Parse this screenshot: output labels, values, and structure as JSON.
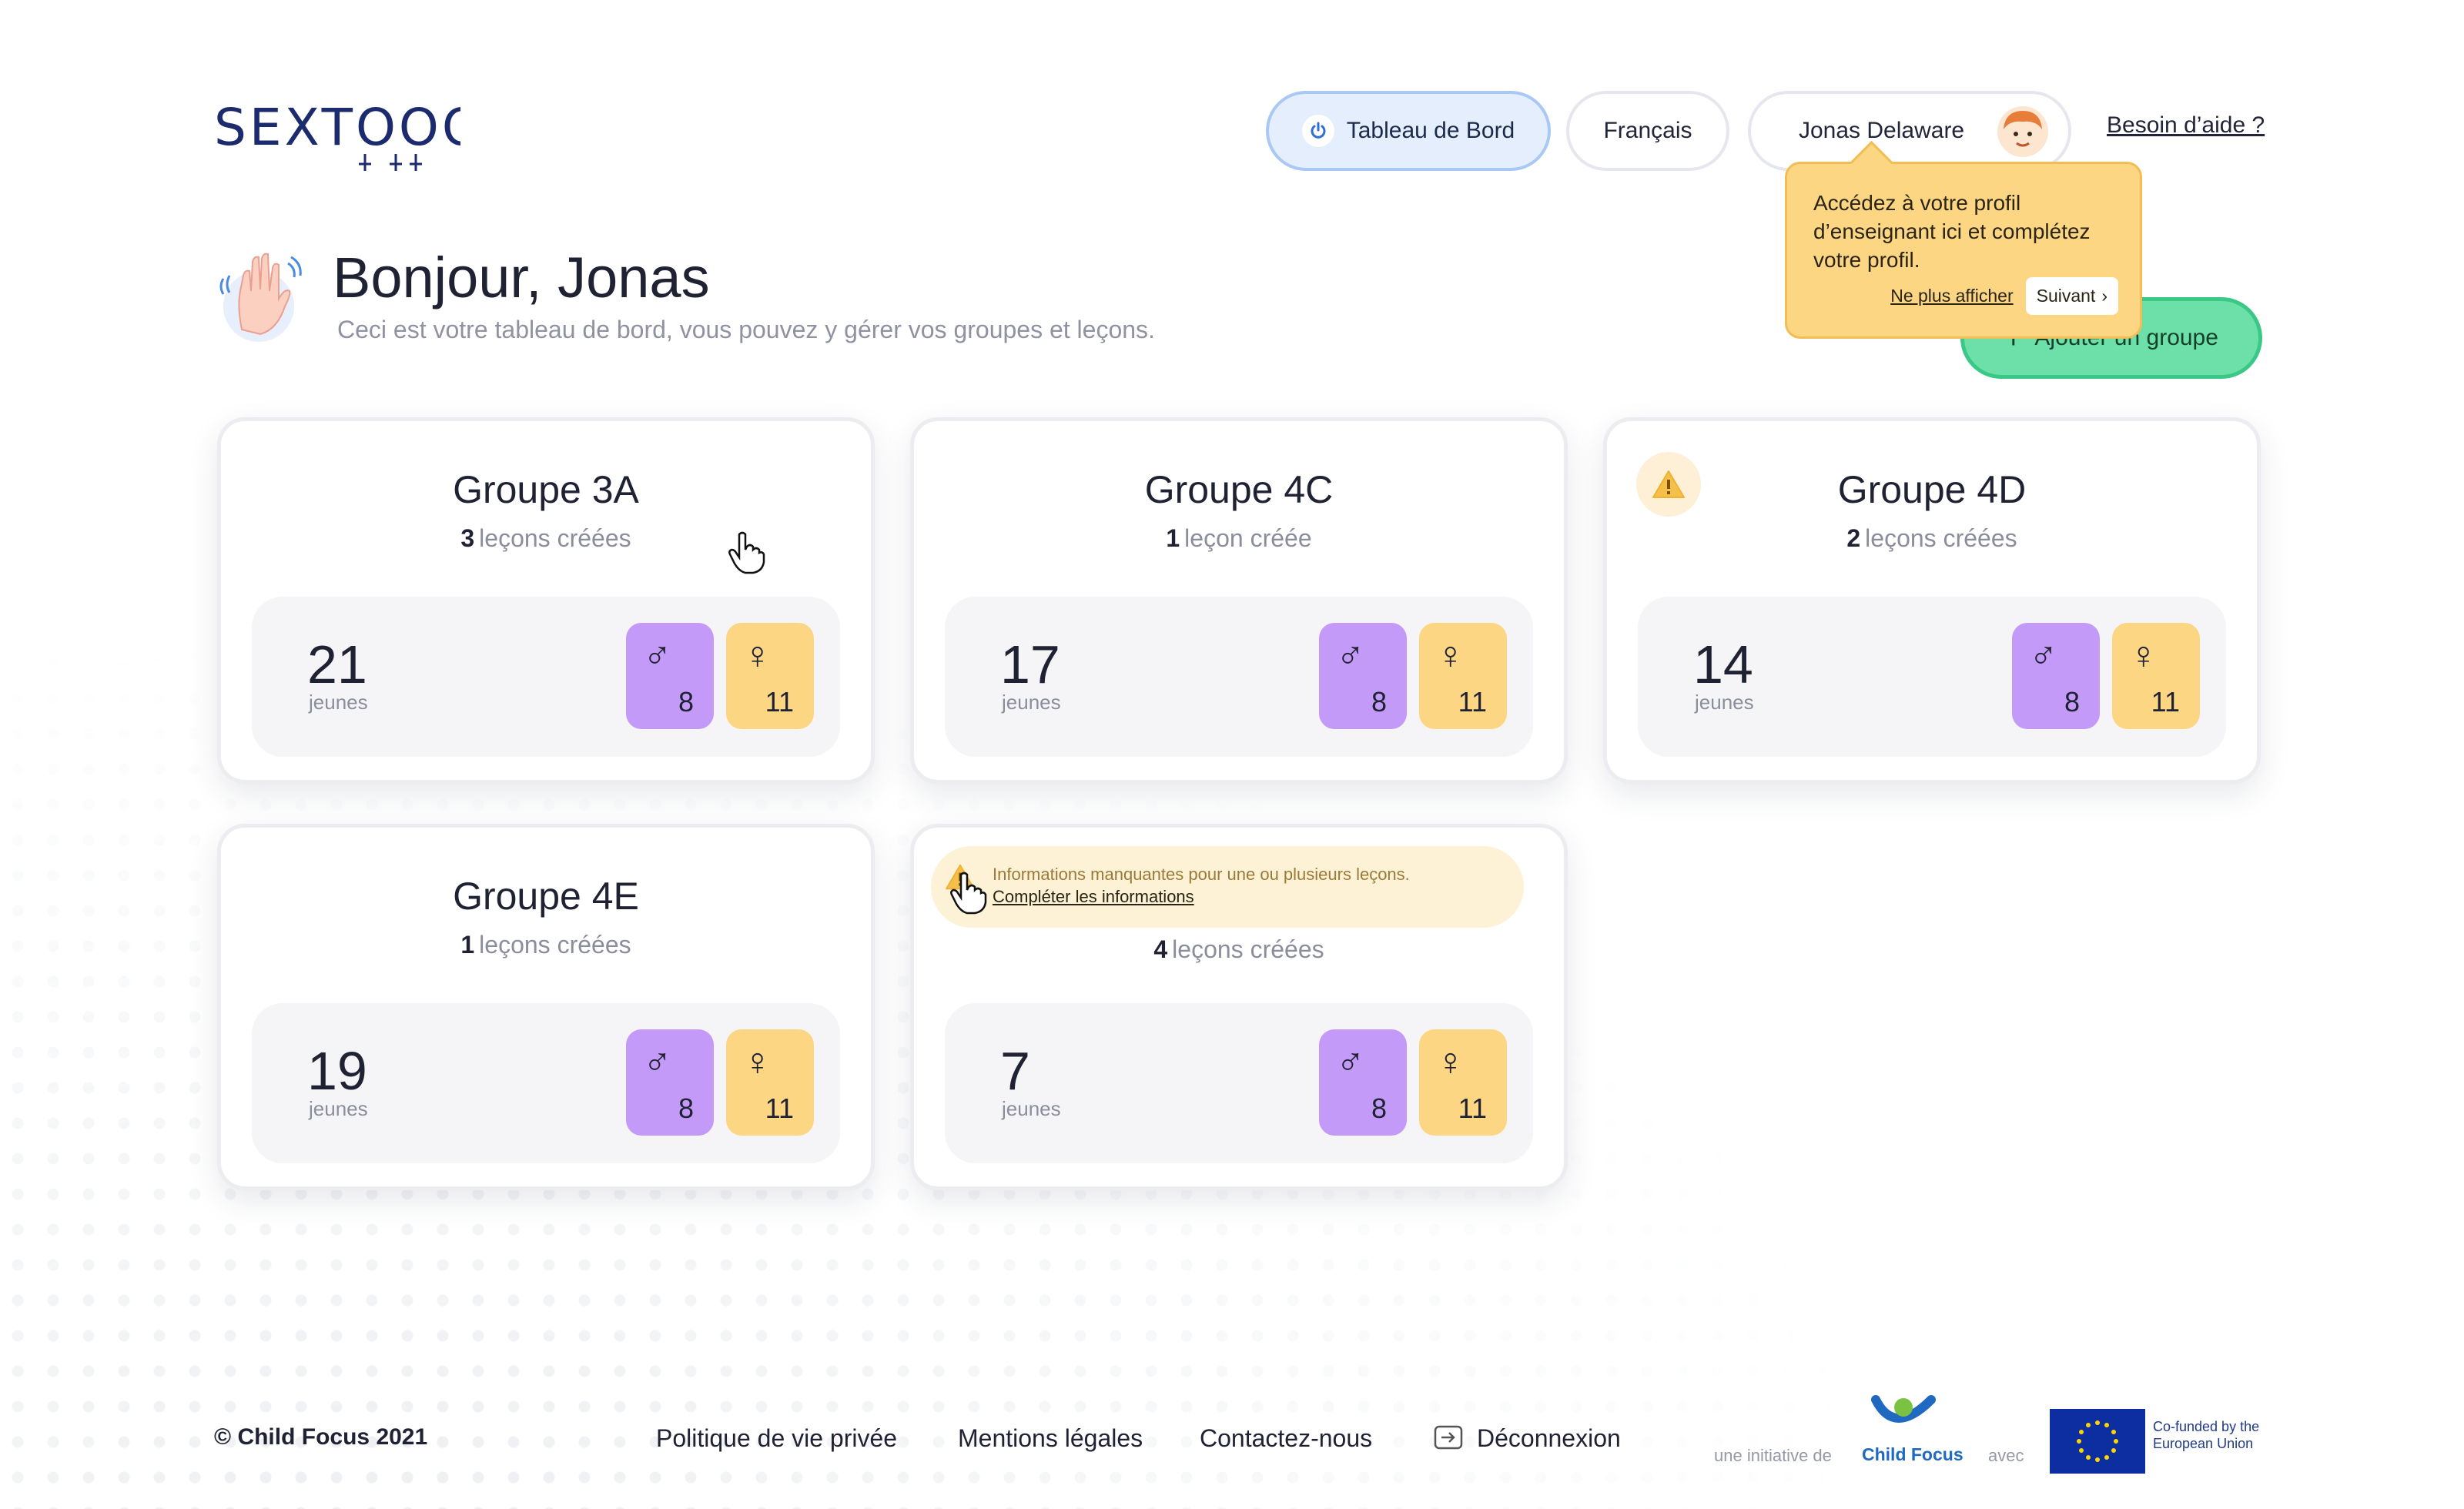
{
  "header": {
    "logo_text": "SEXTOOOH",
    "nav": {
      "dashboard_label": "Tableau de Bord",
      "language_label": "Français",
      "user_name": "Jonas Delaware"
    },
    "help_label": "Besoin d’aide ?"
  },
  "tooltip": {
    "text": "Accédez à votre profil d’enseignant ici et complétez votre profil.",
    "dismiss_label": "Ne plus afficher",
    "next_label": "Suivant"
  },
  "greeting": {
    "title": "Bonjour, Jonas",
    "subtitle": "Ceci est votre tableau de bord, vous pouvez y gérer vos groupes et leçons."
  },
  "add_group_label": "Ajouter un groupe",
  "groups": [
    {
      "name": "Groupe 3A",
      "lessons_count": "3",
      "lessons_label": "leçons créées",
      "total": "21",
      "total_label": "jeunes",
      "boys": "8",
      "girls": "11"
    },
    {
      "name": "Groupe 4C",
      "lessons_count": "1",
      "lessons_label": "leçon créée",
      "total": "17",
      "total_label": "jeunes",
      "boys": "8",
      "girls": "11"
    },
    {
      "name": "Groupe 4D",
      "lessons_count": "2",
      "lessons_label": "leçons créées",
      "total": "14",
      "total_label": "jeunes",
      "boys": "8",
      "girls": "11"
    },
    {
      "name": "Groupe 4E",
      "lessons_count": "1",
      "lessons_label": "leçons créées",
      "total": "19",
      "total_label": "jeunes",
      "boys": "8",
      "girls": "11"
    },
    {
      "name": "",
      "lessons_count": "4",
      "lessons_label": "leçons créées",
      "total": "7",
      "total_label": "jeunes",
      "boys": "8",
      "girls": "11",
      "warning_text": "Informations manquantes pour une ou plusieurs leçons.",
      "warning_link": "Compléter les informations"
    }
  ],
  "gender_symbols": {
    "male": "♂",
    "female": "♀"
  },
  "footer": {
    "copyright": "© Child Focus 2021",
    "links": {
      "privacy": "Politique de vie privée",
      "legal": "Mentions légales",
      "contact": "Contactez-nous",
      "logout": "Déconnexion"
    },
    "initiative_label": "une initiative de",
    "child_focus": "Child Focus",
    "with_label": "avec",
    "eu_text": "Co-funded by the European Union"
  },
  "colors": {
    "boys": "#c39af8",
    "girls": "#fdd684",
    "accent_green": "#6ce0a8",
    "active_nav": "#e4eefc"
  }
}
